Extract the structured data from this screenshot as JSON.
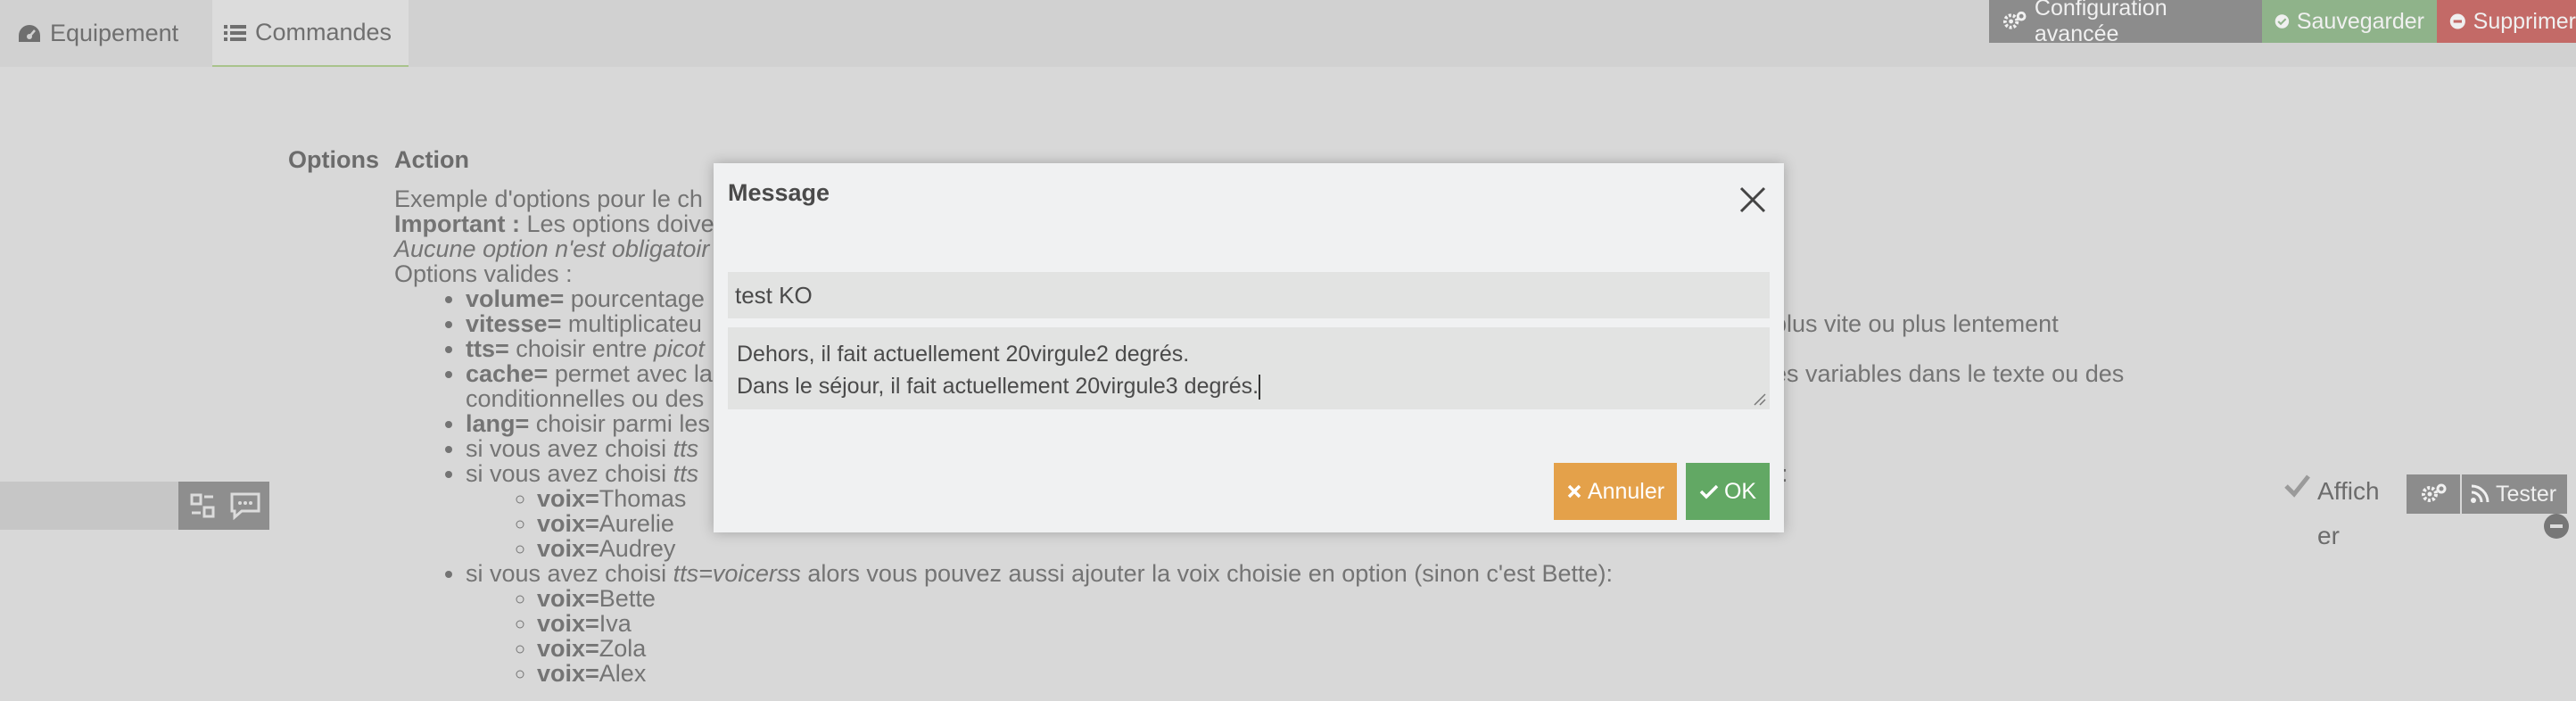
{
  "tabs": {
    "equipement": "Equipement",
    "commandes": "Commandes"
  },
  "toolbar": {
    "config": "Configuration avancée",
    "save": "Sauvegarder",
    "delete": "Supprimer"
  },
  "columns": {
    "options": "Options",
    "action": "Action"
  },
  "help": {
    "line1": "Exemple d'options pour le ch",
    "important_label": "Important :",
    "important_text": " Les options doive",
    "optional_note": "Aucune option n'est obligatoir",
    "valid_options": "Options valides :",
    "items": [
      {
        "key": "volume=",
        "text": " pourcentage"
      },
      {
        "key": "vitesse=",
        "text": " multiplicateu",
        "tail": "plus vite ou plus lentement"
      },
      {
        "key": "tts=",
        "text": " choisir entre ",
        "italic": "picot"
      },
      {
        "key": "cache=",
        "text": " permet avec la",
        "tail": "es variables dans le texte ou des",
        "line2": "conditionnelles ou des"
      },
      {
        "key": "lang=",
        "text": " choisir parmi les"
      },
      {
        "text": "si vous avez choisi ",
        "italic": "tts"
      },
      {
        "text": "si vous avez choisi ",
        "italic": "tts",
        "tail": "):"
      }
    ],
    "voices_1": [
      "Thomas",
      "Aurelie",
      "Audrey"
    ],
    "voicerss_item": {
      "pre": "si vous avez choisi ",
      "italic": "tts=voicerss",
      "post": " alors vous pouvez aussi ajouter la voix choisie en option (sinon c'est Bette):"
    },
    "voices_2": [
      "Bette",
      "Iva",
      "Zola",
      "Alex"
    ],
    "voice_key": "voix="
  },
  "right_panel": {
    "affich": "Affich er",
    "tester": "Tester"
  },
  "modal": {
    "title": "Message",
    "subject_value": "test KO",
    "body_line1": "Dehors, il fait actuellement 20virgule2 degrés.",
    "body_line2": "Dans le séjour, il fait actuellement 20virgule3 degrés.",
    "cancel_label": "Annuler",
    "ok_label": "OK"
  },
  "colors": {
    "save_green": "#8fb38a",
    "delete_red": "#c36a67",
    "cancel_orange": "#e4a14a",
    "ok_green": "#62a864"
  }
}
